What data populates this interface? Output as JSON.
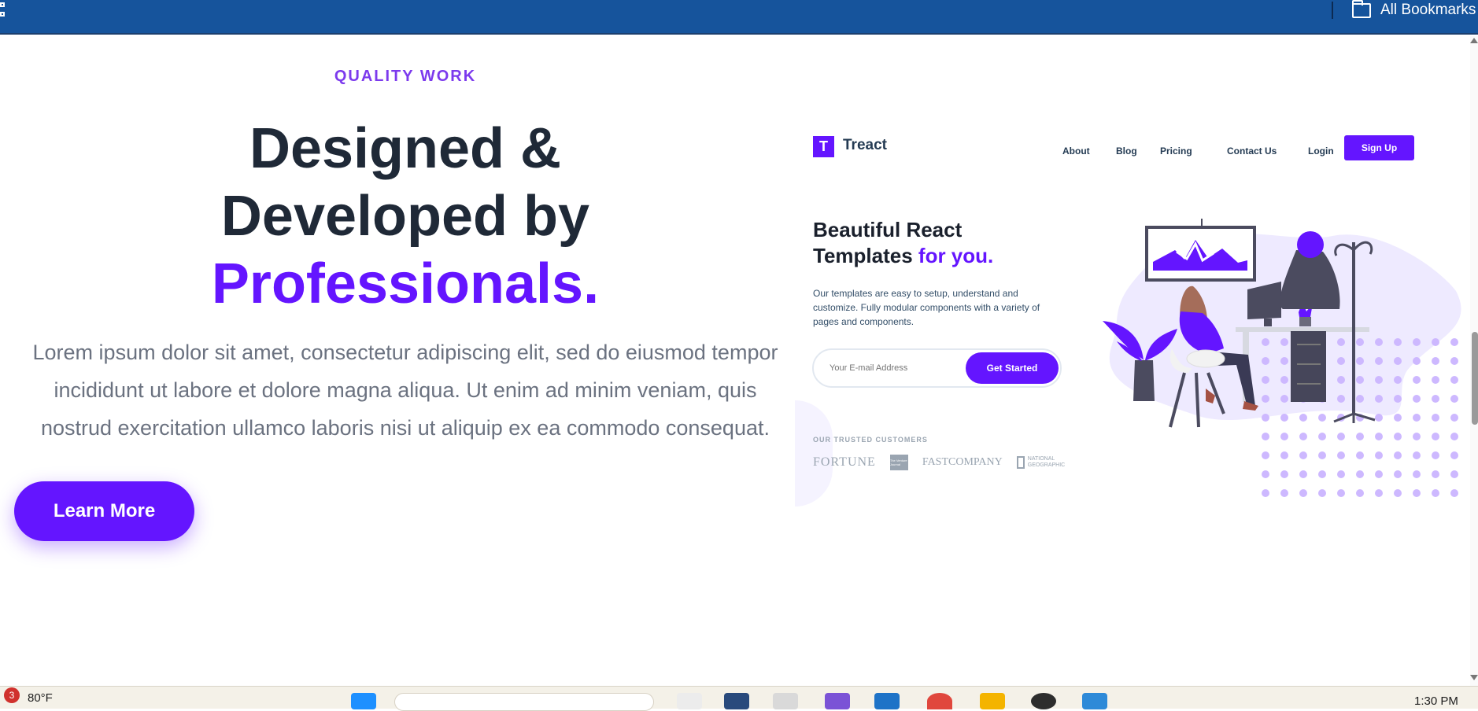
{
  "browser": {
    "bookmarks_label": "All Bookmarks"
  },
  "hero": {
    "eyebrow": "QUALITY WORK",
    "headline_line1": "Designed &",
    "headline_line2": "Developed by",
    "headline_accent": "Professionals.",
    "description": "Lorem ipsum dolor sit amet, consectetur adipiscing elit, sed do eiusmod tempor incididunt ut labore et dolore magna aliqua. Ut enim ad minim veniam, quis nostrud exercitation ullamco laboris nisi ut aliquip ex ea commodo consequat.",
    "button_label": "Learn More"
  },
  "preview": {
    "brand": "Treact",
    "logo_letter": "T",
    "nav": [
      "About",
      "Blog",
      "Pricing",
      "Contact Us"
    ],
    "login": "Login",
    "signup": "Sign Up",
    "title_line1": "Beautiful React",
    "title_line2": "Templates",
    "title_accent": "for you.",
    "copy": "Our templates are easy to setup, understand and customize. Fully modular components with a variety of pages and components.",
    "email_placeholder": "Your E-mail Address",
    "cta": "Get Started",
    "trusted_label": "OUR TRUSTED CUSTOMERS",
    "customers": [
      "FORTUNE",
      "The Venture Journal",
      "FASTCOMPANY",
      "NATIONAL GEOGRAPHIC"
    ]
  },
  "taskbar": {
    "notification_count": "3",
    "weather": "80°F",
    "time": "1:30 PM"
  },
  "colors": {
    "brand": "#6415ff",
    "heading": "#1f2937",
    "eyebrow": "#7c3aed",
    "browser_bar": "#16549c"
  }
}
